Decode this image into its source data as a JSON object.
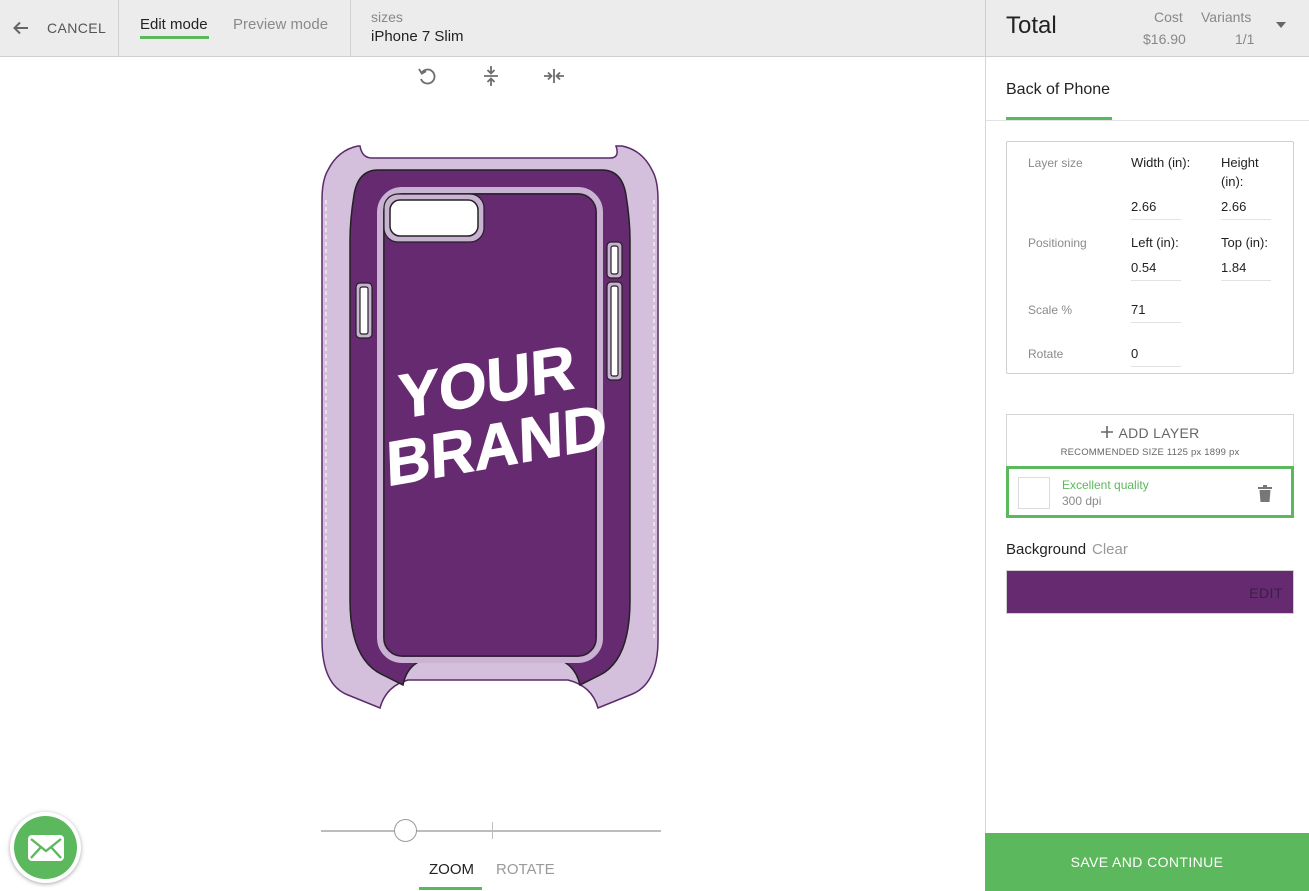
{
  "header": {
    "cancel_label": "CANCEL",
    "edit_mode_label": "Edit mode",
    "preview_mode_label": "Preview mode",
    "sizes_caption": "sizes",
    "sizes_value": "iPhone 7 Slim"
  },
  "summary": {
    "total_label": "Total",
    "cost_caption": "Cost",
    "cost_value": "$16.90",
    "variants_caption": "Variants",
    "variants_value": "1/1"
  },
  "toolbar": {
    "icons": [
      "rotate-reset-icon",
      "center-vertical-icon",
      "center-horizontal-icon"
    ]
  },
  "canvas": {
    "brand_line_1": "YOUR",
    "brand_line_2": "BRAND",
    "case_color": "#d4bfdc",
    "case_outline": "#5a2a6a",
    "print_area_color": "#652a70"
  },
  "bottom": {
    "zoom_fraction": 0.25,
    "tabs": [
      {
        "label": "ZOOM",
        "active": true
      },
      {
        "label": "ROTATE",
        "active": false
      }
    ]
  },
  "panel": {
    "tab_label": "Back of Phone",
    "layer_size_label": "Layer size",
    "width_label": "Width (in):",
    "height_label": "Height (in):",
    "width_value": "2.66",
    "height_value": "2.66",
    "positioning_label": "Positioning",
    "left_label": "Left (in):",
    "top_label": "Top (in):",
    "left_value": "0.54",
    "top_value": "1.84",
    "scale_label": "Scale %",
    "scale_value": "71",
    "rotate_label": "Rotate",
    "rotate_value": "0",
    "add_layer_label": "ADD LAYER",
    "recommended_size": "RECOMMENDED SIZE 1125 px 1899 px",
    "layer_quality": "Excellent quality",
    "layer_dpi": "300 dpi",
    "background_label": "Background",
    "background_clear": "Clear",
    "background_color": "#652a70",
    "background_edit": "EDIT"
  },
  "save_label": "SAVE AND CONTINUE",
  "colors": {
    "accent": "#5cb85c",
    "topbar": "#ececec"
  }
}
